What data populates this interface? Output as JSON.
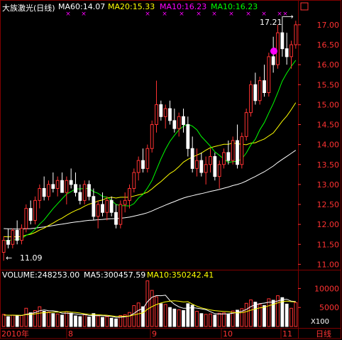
{
  "header": {
    "title": "大族激光(日线)",
    "ma60": "MA60:14.07",
    "ma20": "MA20:15.33",
    "ma10a": "MA10:16.23",
    "ma10b": "MA10:16.23"
  },
  "volume_header": {
    "volume": "VOLUME:248253.00",
    "ma5": "MA5:300457.59",
    "ma10": "MA10:350242.41"
  },
  "annotations": {
    "high_label": "17.21",
    "low_label": "11.09"
  },
  "axis": {
    "price_ticks": [
      "17.00",
      "16.50",
      "16.00",
      "15.50",
      "15.00",
      "14.50",
      "14.00",
      "13.50",
      "13.00",
      "12.50",
      "12.00",
      "11.50",
      "11.00"
    ],
    "volume_ticks": [
      "10000",
      "5000"
    ],
    "volume_unit": "X100",
    "x_labels": [
      "2010年",
      "8",
      "9",
      "10",
      "11"
    ],
    "period_button": "日线"
  },
  "colors": {
    "up": "#ff3232",
    "down": "#ffffff",
    "ma60": "#ffffff",
    "ma20": "#ffff00",
    "ma10": "#00ff00",
    "magenta": "#ff00ff",
    "grid": "#800000",
    "axis_text": "#ff3232"
  },
  "chart_data": {
    "type": "candlestick",
    "price_range": [
      10.9,
      17.3
    ],
    "volume_max": 12500,
    "candles": [
      [
        11.3,
        11.7,
        11.09,
        11.6,
        3200
      ],
      [
        11.6,
        11.9,
        11.4,
        11.5,
        2600
      ],
      [
        11.5,
        11.9,
        11.4,
        11.85,
        3000
      ],
      [
        11.85,
        12.1,
        11.5,
        11.6,
        2800
      ],
      [
        11.6,
        12.0,
        11.5,
        11.9,
        2900
      ],
      [
        11.9,
        12.5,
        11.8,
        12.4,
        4800
      ],
      [
        12.4,
        12.6,
        12.0,
        12.1,
        3600
      ],
      [
        12.1,
        12.7,
        12.0,
        12.6,
        4200
      ],
      [
        12.6,
        13.0,
        12.4,
        12.9,
        5200
      ],
      [
        12.9,
        13.2,
        12.6,
        12.7,
        4000
      ],
      [
        12.7,
        13.1,
        12.6,
        13.0,
        3800
      ],
      [
        13.0,
        13.3,
        12.8,
        12.9,
        3400
      ],
      [
        12.9,
        13.2,
        12.7,
        13.1,
        3300
      ],
      [
        13.1,
        13.3,
        12.8,
        12.8,
        3000
      ],
      [
        12.8,
        13.2,
        12.5,
        13.1,
        3900
      ],
      [
        13.1,
        13.4,
        12.9,
        13.0,
        3500
      ],
      [
        13.0,
        13.3,
        12.7,
        12.8,
        2800
      ],
      [
        12.8,
        13.0,
        12.5,
        12.6,
        2600
      ],
      [
        12.6,
        13.1,
        12.5,
        13.0,
        3100
      ],
      [
        13.0,
        13.1,
        12.6,
        12.7,
        2500
      ],
      [
        12.7,
        12.9,
        12.1,
        12.2,
        3400
      ],
      [
        12.2,
        12.6,
        11.9,
        12.5,
        2800
      ],
      [
        12.5,
        12.8,
        12.2,
        12.3,
        2400
      ],
      [
        12.3,
        12.7,
        12.1,
        12.6,
        2600
      ],
      [
        12.6,
        12.7,
        12.2,
        12.3,
        2200
      ],
      [
        12.3,
        12.5,
        11.9,
        12.0,
        2000
      ],
      [
        12.0,
        12.6,
        11.9,
        12.5,
        2900
      ],
      [
        12.5,
        12.8,
        12.3,
        12.6,
        3100
      ],
      [
        12.6,
        13.0,
        12.4,
        12.9,
        3700
      ],
      [
        12.9,
        13.4,
        12.8,
        13.3,
        5500
      ],
      [
        13.3,
        13.7,
        13.1,
        13.6,
        6200
      ],
      [
        13.6,
        13.9,
        13.3,
        13.4,
        5200
      ],
      [
        13.4,
        14.0,
        13.3,
        13.9,
        12000
      ],
      [
        13.9,
        14.6,
        13.8,
        14.5,
        9500
      ],
      [
        14.5,
        15.6,
        14.3,
        15.0,
        7800
      ],
      [
        15.0,
        15.1,
        14.6,
        14.7,
        6000
      ],
      [
        14.7,
        15.0,
        14.4,
        14.9,
        5800
      ],
      [
        14.9,
        15.1,
        14.5,
        14.6,
        5000
      ],
      [
        14.6,
        14.9,
        14.3,
        14.4,
        4600
      ],
      [
        14.4,
        14.8,
        14.2,
        14.7,
        4400
      ],
      [
        14.7,
        14.9,
        14.3,
        14.5,
        4200
      ],
      [
        14.5,
        14.7,
        13.7,
        13.9,
        6000
      ],
      [
        13.9,
        14.2,
        13.3,
        13.4,
        5600
      ],
      [
        13.4,
        13.9,
        13.2,
        13.6,
        4000
      ],
      [
        13.6,
        13.8,
        13.2,
        13.3,
        3400
      ],
      [
        13.3,
        13.7,
        13.0,
        13.5,
        3200
      ],
      [
        13.5,
        13.9,
        13.3,
        13.7,
        3300
      ],
      [
        13.7,
        13.8,
        13.1,
        13.2,
        3000
      ],
      [
        13.2,
        13.6,
        12.9,
        13.5,
        3500
      ],
      [
        13.5,
        13.9,
        13.4,
        13.8,
        3600
      ],
      [
        13.8,
        14.1,
        13.5,
        13.6,
        3300
      ],
      [
        13.6,
        14.2,
        13.5,
        14.1,
        4100
      ],
      [
        14.1,
        14.5,
        13.4,
        13.5,
        4300
      ],
      [
        13.5,
        14.3,
        13.4,
        14.2,
        4700
      ],
      [
        14.2,
        14.9,
        14.1,
        14.8,
        6100
      ],
      [
        14.8,
        15.6,
        14.7,
        15.5,
        7000
      ],
      [
        15.5,
        15.8,
        15.0,
        15.1,
        6400
      ],
      [
        15.1,
        15.7,
        15.0,
        15.6,
        5800
      ],
      [
        15.6,
        16.0,
        15.2,
        15.3,
        5500
      ],
      [
        15.3,
        16.3,
        15.2,
        16.2,
        7300
      ],
      [
        16.2,
        16.7,
        15.8,
        16.0,
        6900
      ],
      [
        16.0,
        17.0,
        15.9,
        16.8,
        8100
      ],
      [
        16.8,
        17.21,
        16.2,
        16.4,
        7600
      ],
      [
        16.4,
        16.8,
        16.0,
        16.2,
        5900
      ],
      [
        16.2,
        16.6,
        15.9,
        16.5,
        4800
      ],
      [
        16.5,
        17.1,
        16.4,
        17.0,
        6300
      ]
    ]
  }
}
